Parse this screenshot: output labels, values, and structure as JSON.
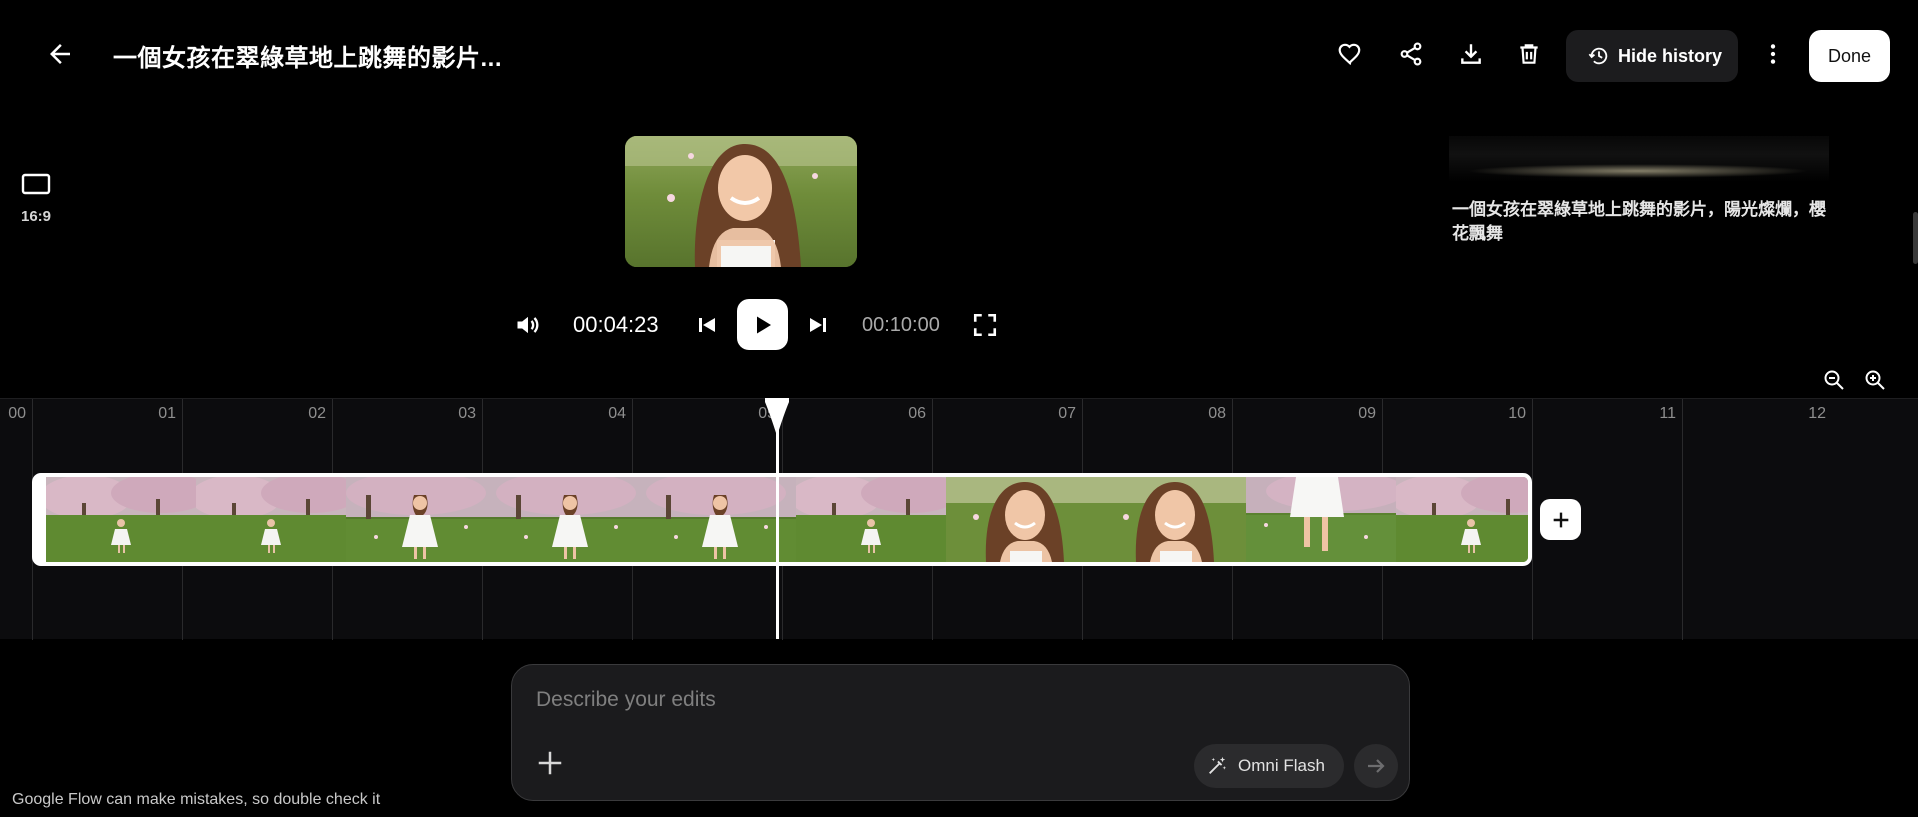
{
  "header": {
    "title": "一個女孩在翠綠草地上跳舞的影片...",
    "hide_history_label": "Hide history",
    "done_label": "Done"
  },
  "aspect": {
    "label": "16:9"
  },
  "player": {
    "current_time": "00:04:23",
    "total_time": "00:10:00"
  },
  "history": {
    "item_text": "一個女孩在翠綠草地上跳舞的影片，陽光燦爛，櫻花飄舞"
  },
  "timeline": {
    "ticks": [
      "00",
      "01",
      "02",
      "03",
      "04",
      "05",
      "06",
      "07",
      "08",
      "09",
      "10",
      "11",
      "12"
    ],
    "frames": [
      "far",
      "far",
      "mid",
      "mid",
      "mid",
      "far",
      "face",
      "face",
      "legs",
      "far"
    ]
  },
  "prompt": {
    "placeholder": "Describe your edits",
    "model_label": "Omni Flash"
  },
  "footer": {
    "disclaimer": "Google Flow can make mistakes, so double check it"
  },
  "colors": {
    "background": "#000000",
    "panel": "#1b1b1d",
    "timeline_bg": "#0c0c0e"
  }
}
